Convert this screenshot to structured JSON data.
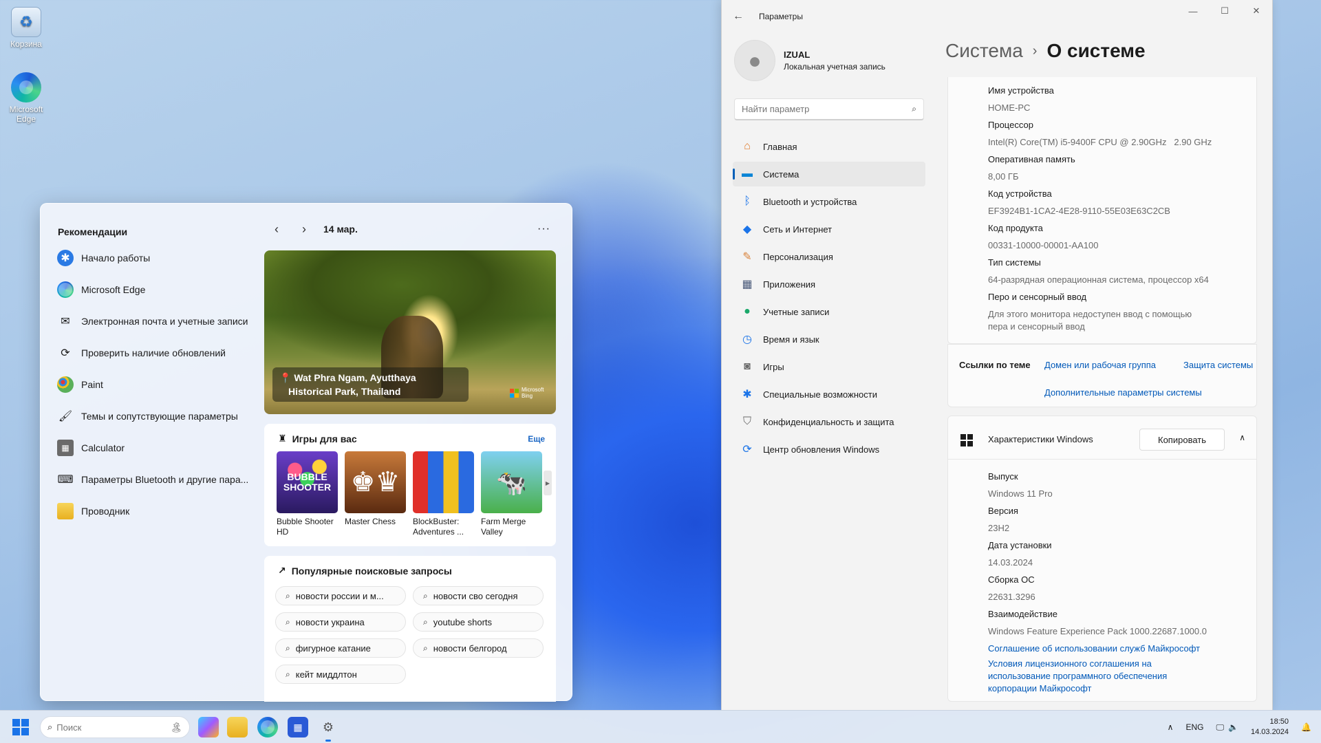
{
  "desktop": {
    "icons": [
      {
        "label": "Корзина",
        "icon": "recycle-bin-icon"
      },
      {
        "label": "Microsoft Edge",
        "icon": "edge-icon"
      }
    ]
  },
  "flyout": {
    "title": "Рекомендации",
    "items": [
      {
        "label": "Начало работы",
        "icon": "get-started-icon",
        "color": "#2a7ae4"
      },
      {
        "label": "Microsoft Edge",
        "icon": "edge-icon",
        "color": "#1aa2c9"
      },
      {
        "label": "Электронная почта и учетные записи",
        "icon": "mail-icon",
        "color": "#333333"
      },
      {
        "label": "Проверить наличие обновлений",
        "icon": "sync-icon",
        "color": "#333333"
      },
      {
        "label": "Paint",
        "icon": "paint-icon",
        "color": "#e8a23a"
      },
      {
        "label": "Темы и сопутствующие параметры",
        "icon": "brush-icon",
        "color": "#333333"
      },
      {
        "label": "Calculator",
        "icon": "calculator-icon",
        "color": "#555555"
      },
      {
        "label": "Параметры Bluetooth и другие пара...",
        "icon": "bluetooth-devices-icon",
        "color": "#333333"
      },
      {
        "label": "Проводник",
        "icon": "folder-icon",
        "color": "#f2c230"
      }
    ],
    "date": "14 мар.",
    "hero_caption_line1": "Wat Phra Ngam, Ayutthaya",
    "hero_caption_line2": "Historical Park, Thailand",
    "bing_label": "Microsoft Bing",
    "games": {
      "title": "Игры для вас",
      "more": "Еще",
      "items": [
        {
          "name": "Bubble Shooter HD",
          "thumb_text": "BUBBLE SHOOTER"
        },
        {
          "name": "Master Chess",
          "thumb_text": "♚♛"
        },
        {
          "name": "BlockBuster: Adventures ...",
          "thumb_text": ""
        },
        {
          "name": "Farm Merge Valley",
          "thumb_text": "🐄"
        }
      ]
    },
    "searches": {
      "title": "Популярные поисковые запросы",
      "items": [
        "новости россии и м...",
        "новости сво сегодня",
        "новости украина",
        "youtube shorts",
        "фигурное катание",
        "новости белгород",
        "кейт миддлтон"
      ]
    }
  },
  "settings": {
    "window_title": "Параметры",
    "user": {
      "name": "IZUAL",
      "type": "Локальная учетная запись"
    },
    "search_placeholder": "Найти параметр",
    "nav": [
      {
        "label": "Главная",
        "icon": "home-icon",
        "color": "#e07a2a"
      },
      {
        "label": "Система",
        "icon": "system-icon",
        "color": "#0a84d6"
      },
      {
        "label": "Bluetooth и устройства",
        "icon": "bluetooth-icon",
        "color": "#1a73e8"
      },
      {
        "label": "Сеть и Интернет",
        "icon": "wifi-icon",
        "color": "#1a73e8"
      },
      {
        "label": "Персонализация",
        "icon": "brush-icon",
        "color": "#d9823a"
      },
      {
        "label": "Приложения",
        "icon": "apps-icon",
        "color": "#4a5a7a"
      },
      {
        "label": "Учетные записи",
        "icon": "accounts-icon",
        "color": "#1aa86a"
      },
      {
        "label": "Время и язык",
        "icon": "globe-clock-icon",
        "color": "#1a73e8"
      },
      {
        "label": "Игры",
        "icon": "gamepad-icon",
        "color": "#6a6a6a"
      },
      {
        "label": "Специальные возможности",
        "icon": "accessibility-icon",
        "color": "#1a73e8"
      },
      {
        "label": "Конфиденциальность и защита",
        "icon": "shield-icon",
        "color": "#6a6a6a"
      },
      {
        "label": "Центр обновления Windows",
        "icon": "windows-update-icon",
        "color": "#1a73e8"
      }
    ],
    "breadcrumb_parent": "Система",
    "breadcrumb_sep": "›",
    "page_title": "О системе",
    "device_specs": [
      {
        "key": "Имя устройства",
        "value": "HOME-PC"
      },
      {
        "key": "Процессор",
        "value": "Intel(R) Core(TM) i5-9400F CPU @ 2.90GHz   2.90 GHz"
      },
      {
        "key": "Оперативная память",
        "value": "8,00 ГБ"
      },
      {
        "key": "Код устройства",
        "value": "EF3924B1-1CA2-4E28-9110-55E03E63C2CB"
      },
      {
        "key": "Код продукта",
        "value": "00331-10000-00001-AA100"
      },
      {
        "key": "Тип системы",
        "value": "64-разрядная операционная система, процессор x64"
      },
      {
        "key": "Перо и сенсорный ввод",
        "value": "Для этого монитора недоступен ввод с помощью",
        "value2": "пера и сенсорный ввод"
      }
    ],
    "links": {
      "label": "Ссылки по теме",
      "domain": "Домен или рабочая группа",
      "protection": "Защита системы",
      "advanced": "Дополнительные параметры системы"
    },
    "windows_specs": {
      "title": "Характеристики Windows",
      "copy_label": "Копировать",
      "items": [
        {
          "key": "Выпуск",
          "value": "Windows 11 Pro"
        },
        {
          "key": "Версия",
          "value": "23H2"
        },
        {
          "key": "Дата установки",
          "value": "14.03.2024"
        },
        {
          "key": "Сборка ОС",
          "value": "22631.3296"
        },
        {
          "key": "Взаимодействие",
          "value": "Windows Feature Experience Pack 1000.22687.1000.0"
        }
      ],
      "link_services": "Соглашение об использовании служб Майкрософт",
      "link_license_1": "Условия лицензионного соглашения на",
      "link_license_2": "использование программного обеспечения",
      "link_license_3": "корпорации Майкрософт"
    }
  },
  "taskbar": {
    "search_placeholder": "Поиск",
    "lang": "ENG",
    "time": "18:50",
    "date": "14.03.2024"
  }
}
